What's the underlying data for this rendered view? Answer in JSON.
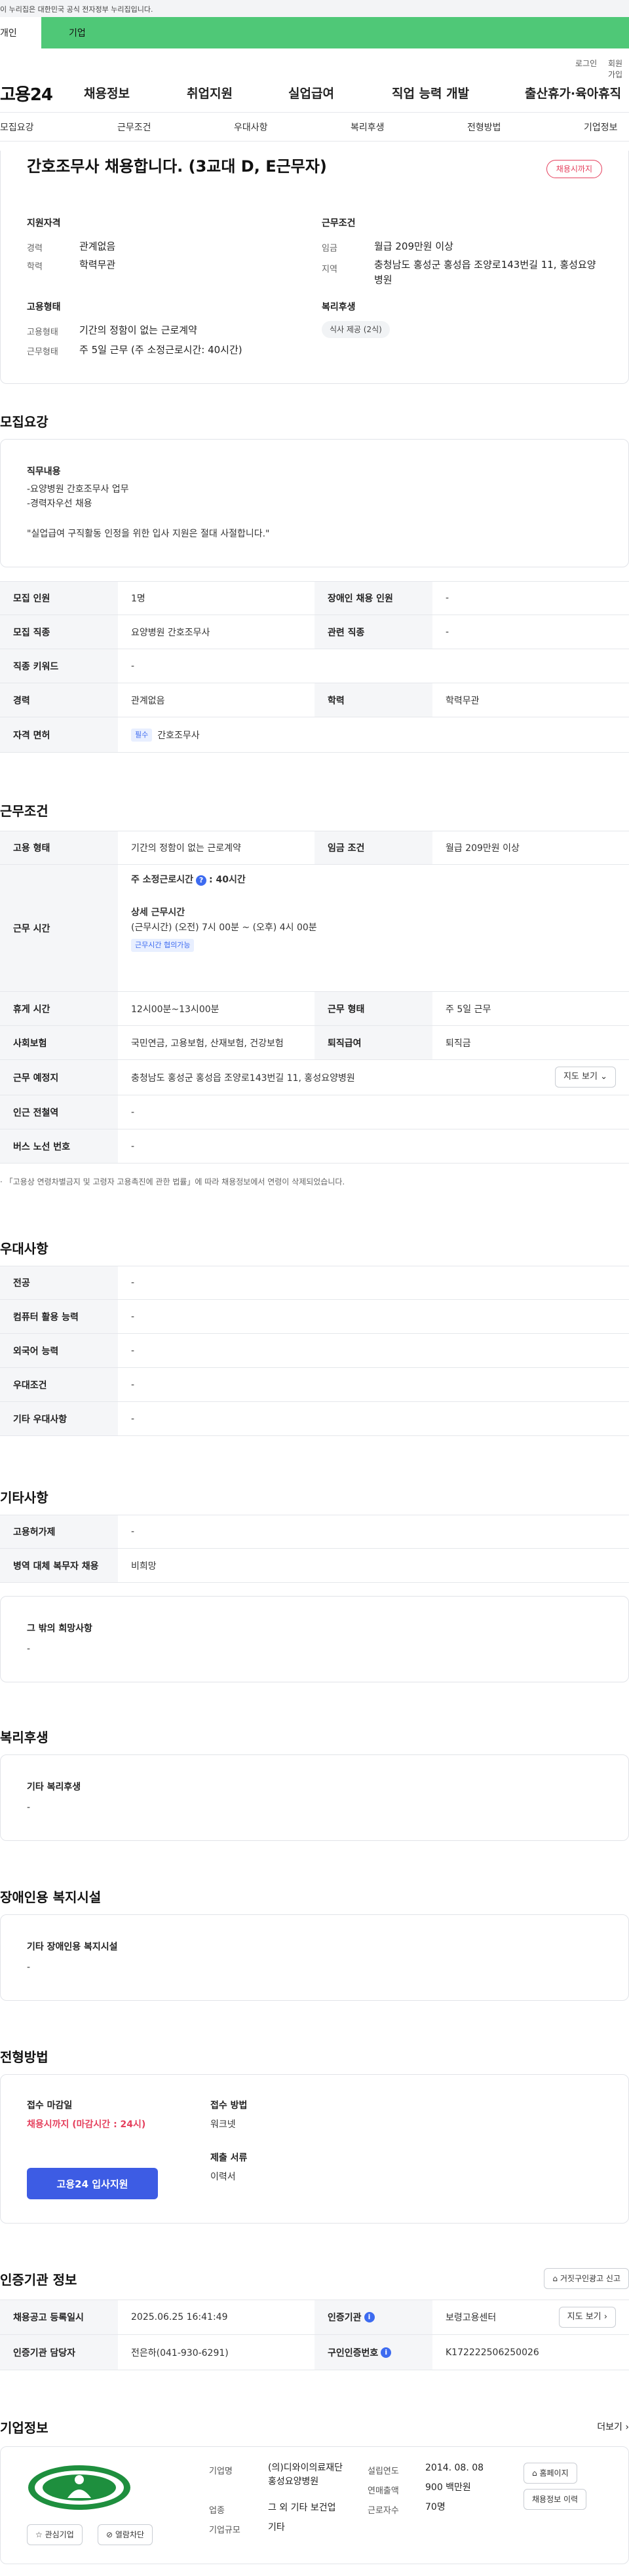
{
  "gov_banner": "이 누리집은 대한민국 공식 전자정부 누리집입니다.",
  "audience_tabs": [
    "개인",
    "기업"
  ],
  "util": {
    "login": "로그인",
    "signup": "회원가입"
  },
  "logo": "고용24",
  "gnb": [
    "채용정보",
    "취업지원",
    "실업급여",
    "직업 능력 개발",
    "출산휴가·육아휴직"
  ],
  "subnav": [
    "모집요강",
    "근무조건",
    "우대사항",
    "복리후생",
    "전형방법",
    "기업정보"
  ],
  "summary": {
    "title": "간호조무사 채용합니다. (3교대 D, E근무자)",
    "status": "채용시까지",
    "qual_title": "지원자격",
    "qual": [
      {
        "label": "경력",
        "value": "관계없음"
      },
      {
        "label": "학력",
        "value": "학력무관"
      }
    ],
    "cond_title": "근무조건",
    "cond": [
      {
        "label": "임금",
        "value": "월급 209만원 이상"
      },
      {
        "label": "지역",
        "value": "충청남도 홍성군 홍성읍 조양로143번길 11, 홍성요양병원"
      }
    ],
    "emp_title": "고용형태",
    "emp": [
      {
        "label": "고용형태",
        "value": "기간의 정함이 없는 근로계약"
      },
      {
        "label": "근무형태",
        "value": "주 5일 근무 (주 소정근로시간: 40시간)"
      }
    ],
    "welfare_title": "복리후생",
    "welfare_chip": "식사 제공 (2식)"
  },
  "recruit": {
    "title": "모집요강",
    "duty_title": "직무내용",
    "duty_lines": [
      "-요양병원 간호조무사 업무",
      "-경력자우선 채용"
    ],
    "duty_note": "\"실업급여 구직활동 인정을 위한 입사 지원은 절대 사절합니다.\"",
    "rows": [
      {
        "l1": "모집 인원",
        "v1": "1명",
        "l2": "장애인 채용 인원",
        "v2": "-"
      },
      {
        "l1": "모집 직종",
        "v1": "요양병원 간호조무사",
        "l2": "관련 직종",
        "v2": "-"
      },
      {
        "l1": "직종 키워드",
        "v1": "-"
      },
      {
        "l1": "경력",
        "v1": "관계없음",
        "l2": "학력",
        "v2": "학력무관"
      },
      {
        "l1": "자격 면허",
        "tag": "필수",
        "v1": "간호조무사"
      }
    ]
  },
  "work": {
    "title": "근무조건",
    "emp_type_label": "고용 형태",
    "emp_type": "기간의 정함이 없는 근로계약",
    "wage_label": "임금 조건",
    "wage": "월급 209만원 이상",
    "hours_label": "근무 시간",
    "hours_weekly": "주 소정근로시간",
    "hours_weekly_val": ": 40시간",
    "hours_detail_title": "상세 근무시간",
    "hours_detail": "(근무시간) (오전) 7시 00분 ~ (오후) 4시 00분",
    "hours_tag": "근무시간 협의가능",
    "break_label": "휴게 시간",
    "break": "12시00분~13시00분",
    "form_label": "근무 형태",
    "form": "주 5일 근무",
    "ins_label": "사회보험",
    "ins": "국민연금, 고용보험, 산재보험, 건강보험",
    "sev_label": "퇴직급여",
    "sev": "퇴직금",
    "place_label": "근무 예정지",
    "place": "충청남도 홍성군 홍성읍 조양로143번길 11, 홍성요양병원",
    "map_btn": "지도 보기",
    "station_label": "인근 전철역",
    "station": "-",
    "bus_label": "버스 노선 번호",
    "bus": "-",
    "note": "「고용상 연령차별금지 및 고령자 고용촉진에 관한 법률」에 따라 채용정보에서 연령이 삭제되었습니다."
  },
  "pref": {
    "title": "우대사항",
    "rows": [
      {
        "l": "전공",
        "v": "-"
      },
      {
        "l": "컴퓨터 활용 능력",
        "v": "-"
      },
      {
        "l": "외국어 능력",
        "v": "-"
      },
      {
        "l": "우대조건",
        "v": "-"
      },
      {
        "l": "기타 우대사항",
        "v": "-"
      }
    ]
  },
  "etc": {
    "title": "기타사항",
    "rows": [
      {
        "l": "고용허가제",
        "v": "-"
      },
      {
        "l": "병역 대체 복무자 채용",
        "v": "비희망"
      }
    ],
    "box_title": "그 밖의 희망사항",
    "box_val": "-"
  },
  "benefit": {
    "title": "복리후생",
    "box_title": "기타 복리후생",
    "box_val": "-"
  },
  "disabled": {
    "title": "장애인용 복지시설",
    "box_title": "기타 장애인용 복지시설",
    "box_val": "-"
  },
  "process": {
    "title": "전형방법",
    "deadline_label": "접수 마감일",
    "deadline": "채용시까지 (마감시간 : 24시)",
    "apply_btn": "고용24 입사지원",
    "method_label": "접수 방법",
    "method": "워크넷",
    "docs_label": "제출 서류",
    "docs": "이력서"
  },
  "cert": {
    "title": "인증기관 정보",
    "report_btn": "거짓구인광고 신고",
    "reg_label": "채용공고 등록일시",
    "reg": "2025.06.25 16:41:49",
    "org_label": "인증기관",
    "org": "보령고용센터",
    "detail_btn": "지도 보기",
    "mgr_label": "인증기관 담당자",
    "mgr": "전은하(041-930-6291)",
    "num_label": "구인인증번호",
    "num": "K172222506250026"
  },
  "company": {
    "title": "기업정보",
    "more": "더보기",
    "fav_btn": "관심기업",
    "block_btn": "열람차단",
    "name_label": "기업명",
    "name": "(의)디와이의료재단홍성요양병원",
    "ind_label": "업종",
    "ind": "그 외 기타 보건업",
    "size_label": "기업규모",
    "size": "기타",
    "est_label": "설립연도",
    "est": "2014. 08. 08",
    "sales_label": "연매출액",
    "sales": "900 백만원",
    "emp_label": "근로자수",
    "emp": "70명",
    "home_btn": "홈페이지",
    "history_btn": "채용정보 이력"
  },
  "colors": {
    "accent": "#3d5ce4",
    "green": "#4fc877",
    "red": "#e5415e"
  }
}
